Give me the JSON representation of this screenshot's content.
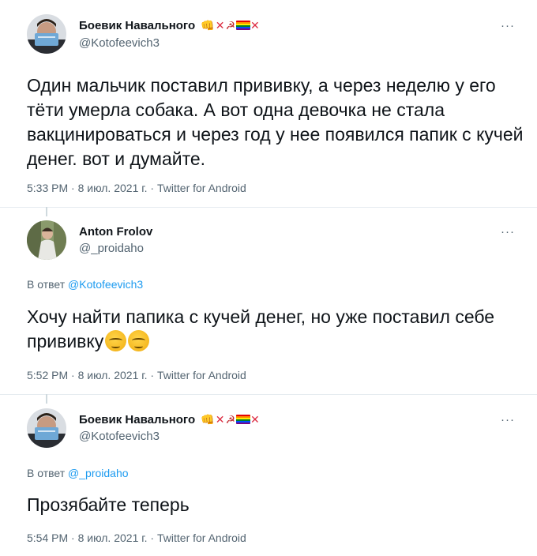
{
  "tweets": [
    {
      "author": "Боевик Навального",
      "handle": "@Kotofeevich3",
      "reply_label": "",
      "reply_to": "",
      "text": "Один мальчик поставил прививку, а через неделю у его тёти умерла собака. А вот одна девочка не стала вакцинироваться и через год у нее появился папик с кучей денег. вот и думайте.",
      "time": "5:33 PM · 8 июл. 2021 г.",
      "source": "Twitter for Android",
      "more": "···"
    },
    {
      "author": "Anton Frolov",
      "handle": "@_proidaho",
      "reply_label": "В ответ",
      "reply_to": "@Kotofeevich3",
      "text": "Хочу найти папика с кучей денег, но уже поставил себе прививку",
      "time": "5:52 PM · 8 июл. 2021 г.",
      "source": "Twitter for Android",
      "more": "···"
    },
    {
      "author": "Боевик Навального",
      "handle": "@Kotofeevich3",
      "reply_label": "В ответ",
      "reply_to": "@_proidaho",
      "text": "Прозябайте теперь",
      "time": "5:54 PM · 8 июл. 2021 г.",
      "source": "Twitter for Android",
      "more": "···"
    }
  ],
  "separator": " · ",
  "colors": {
    "text": "#0f1419",
    "secondary": "#536471",
    "link": "#1d9bf0",
    "divider": "#e6ecf0"
  },
  "icons": {
    "name_emoji": [
      "fist-icon",
      "cross-mark-icon",
      "hammer-sickle-icon",
      "rainbow-flag-icon",
      "cross-mark-icon"
    ],
    "reply_emoji": [
      "pensive-face-icon",
      "pensive-face-icon"
    ]
  }
}
